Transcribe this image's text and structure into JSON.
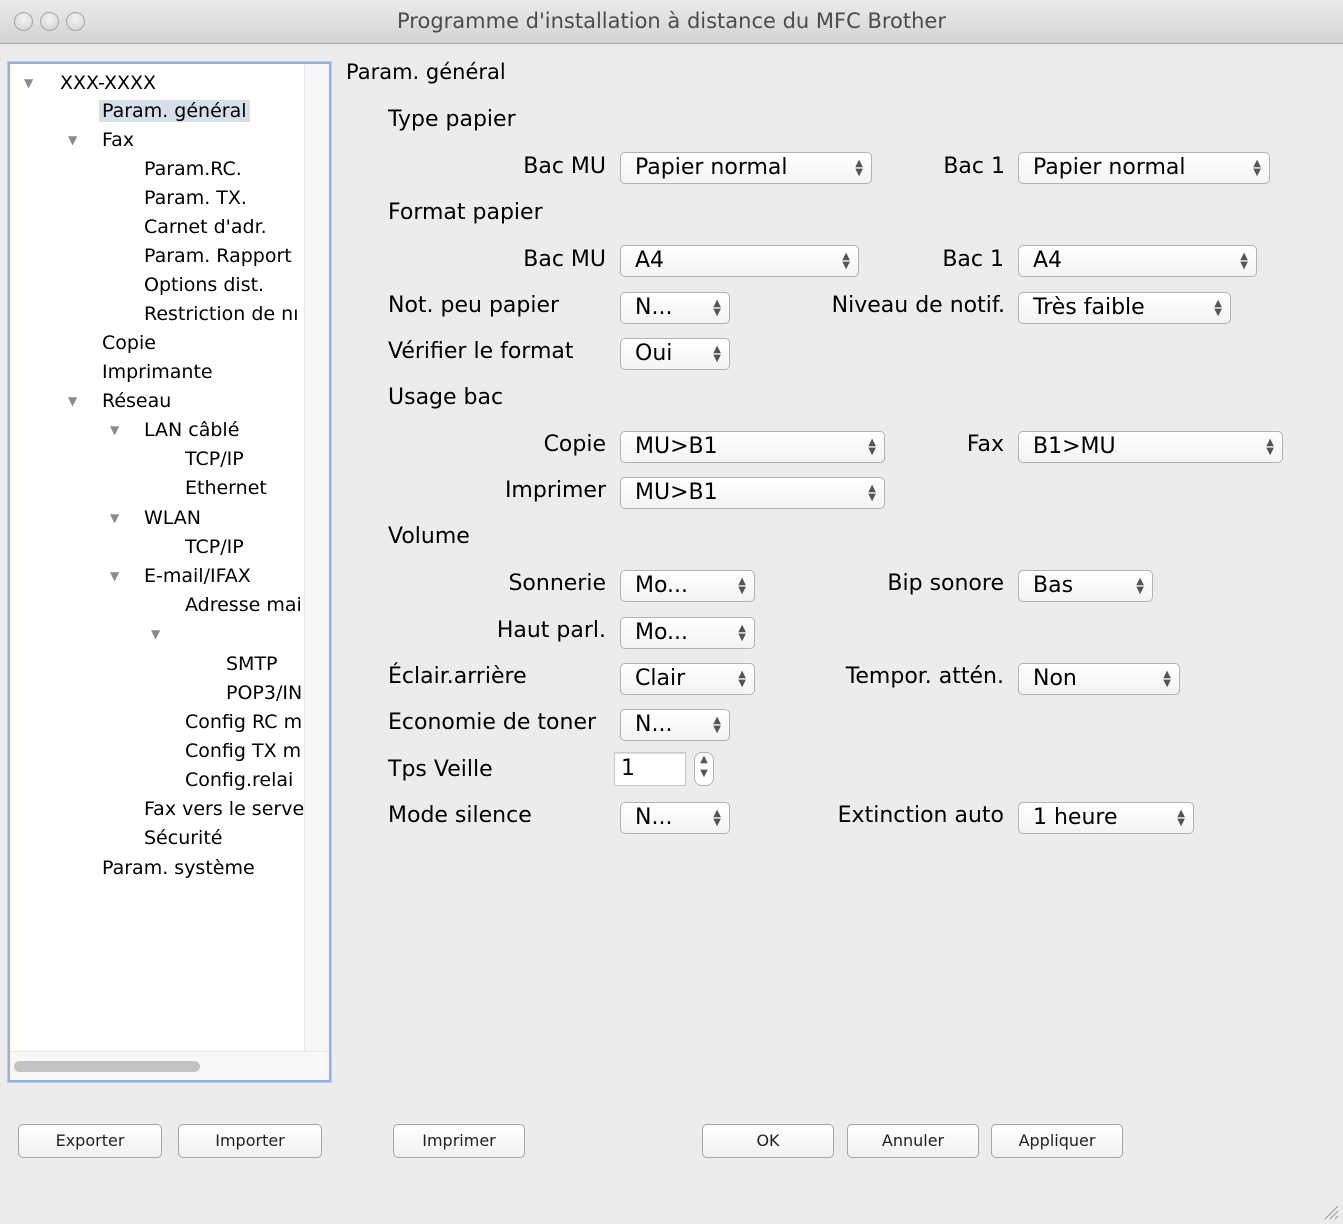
{
  "window": {
    "title": "Programme d'installation à distance du MFC Brother"
  },
  "tree": {
    "items": [
      {
        "label": "XXX-XXXX"
      },
      {
        "label": "Param. général"
      },
      {
        "label": "Fax"
      },
      {
        "label": "Param.RC."
      },
      {
        "label": "Param. TX."
      },
      {
        "label": "Carnet d'adr."
      },
      {
        "label": "Param. Rapport"
      },
      {
        "label": "Options dist."
      },
      {
        "label": "Restriction de nı"
      },
      {
        "label": "Copie"
      },
      {
        "label": "Imprimante"
      },
      {
        "label": "Réseau"
      },
      {
        "label": "LAN câblé"
      },
      {
        "label": "TCP/IP"
      },
      {
        "label": "Ethernet"
      },
      {
        "label": "WLAN"
      },
      {
        "label": "TCP/IP"
      },
      {
        "label": "E-mail/IFAX"
      },
      {
        "label": "Adresse mai"
      },
      {
        "label": ""
      },
      {
        "label": "SMTP"
      },
      {
        "label": "POP3/IN"
      },
      {
        "label": "Config RC m"
      },
      {
        "label": "Config TX m"
      },
      {
        "label": "Config.relai"
      },
      {
        "label": "Fax vers le serve"
      },
      {
        "label": "Sécurité"
      },
      {
        "label": "Param. système"
      }
    ]
  },
  "main": {
    "heading": "Param. général",
    "type_papier": {
      "title": "Type papier",
      "bac_mu_label": "Bac MU",
      "bac_mu_value": "Papier normal",
      "bac1_label": "Bac 1",
      "bac1_value": "Papier normal"
    },
    "format_papier": {
      "title": "Format papier",
      "bac_mu_label": "Bac MU",
      "bac_mu_value": "A4",
      "bac1_label": "Bac 1",
      "bac1_value": "A4"
    },
    "not_peu_papier": {
      "label": "Not. peu papier",
      "value": "N..."
    },
    "niveau_notif": {
      "label": "Niveau de notif.",
      "value": "Très faible"
    },
    "verifier_format": {
      "label": "Vérifier le format",
      "value": "Oui"
    },
    "usage_bac": {
      "title": "Usage bac",
      "copie_label": "Copie",
      "copie_value": "MU>B1",
      "fax_label": "Fax",
      "fax_value": "B1>MU",
      "imprimer_label": "Imprimer",
      "imprimer_value": "MU>B1"
    },
    "volume": {
      "title": "Volume",
      "sonnerie_label": "Sonnerie",
      "sonnerie_value": "Mo...",
      "bip_label": "Bip sonore",
      "bip_value": "Bas",
      "haut_parl_label": "Haut parl.",
      "haut_parl_value": "Mo..."
    },
    "eclair": {
      "label": "Éclair.arrière",
      "value": "Clair"
    },
    "tempor": {
      "label": "Tempor. attén.",
      "value": "Non"
    },
    "economie": {
      "label": "Economie de toner",
      "value": "N..."
    },
    "tps_veille": {
      "label": "Tps Veille",
      "value": "1"
    },
    "mode_silence": {
      "label": "Mode silence",
      "value": "N..."
    },
    "extinction": {
      "label": "Extinction auto",
      "value": "1 heure"
    }
  },
  "buttons": {
    "exporter": "Exporter",
    "importer": "Importer",
    "imprimer": "Imprimer",
    "ok": "OK",
    "annuler": "Annuler",
    "appliquer": "Appliquer"
  }
}
